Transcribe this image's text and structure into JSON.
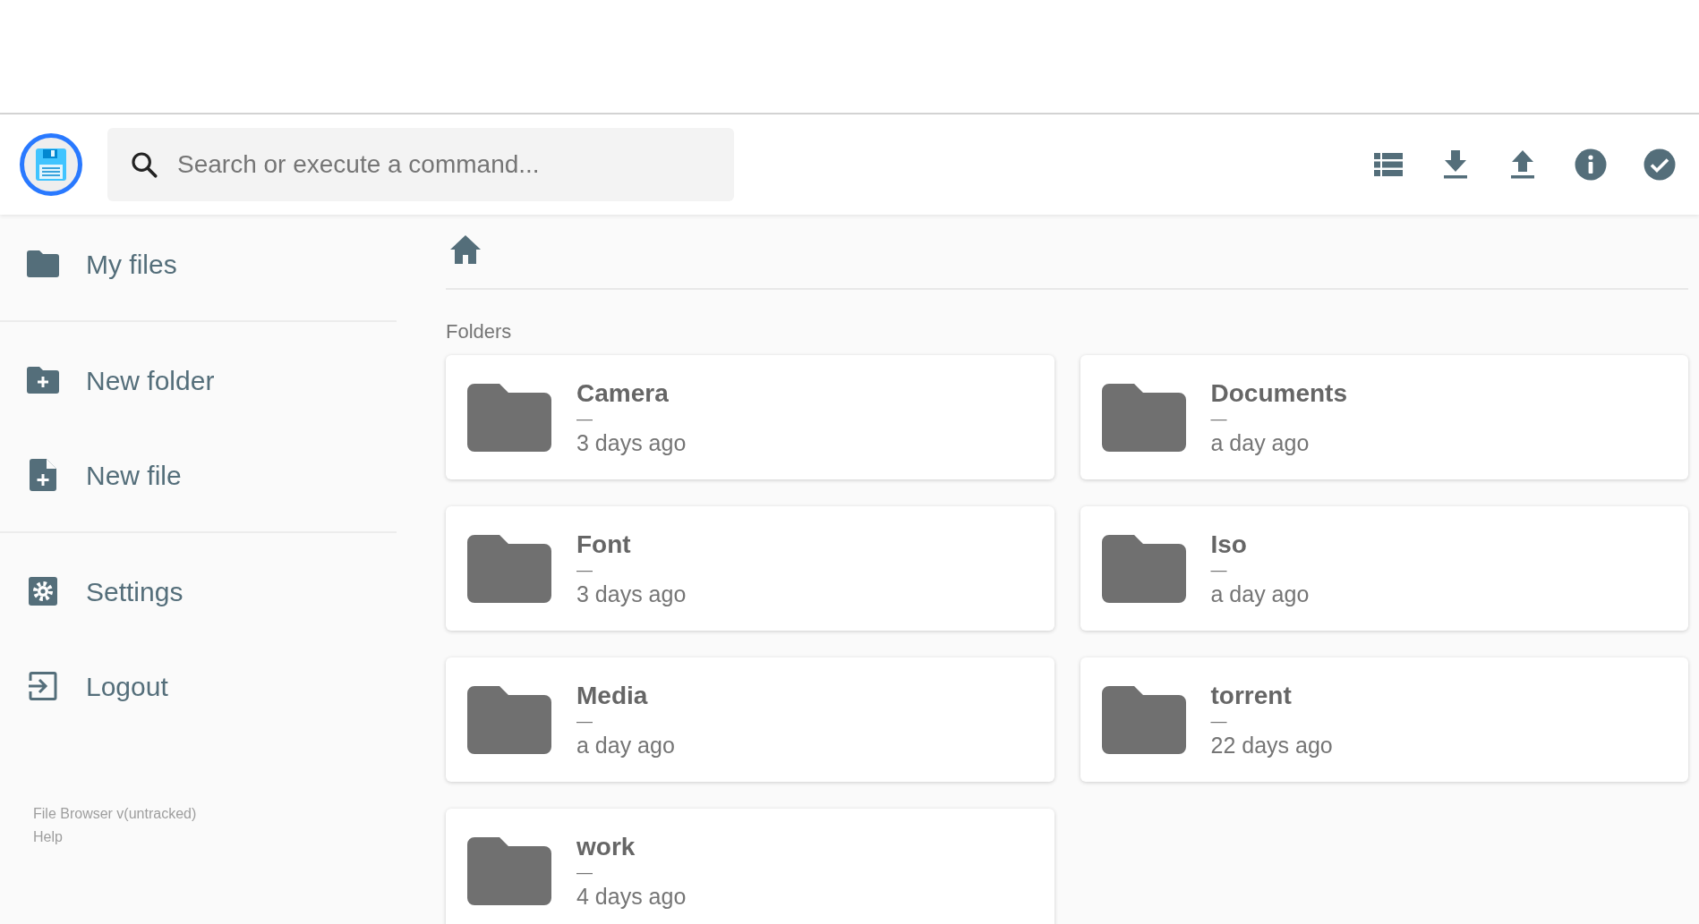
{
  "header": {
    "search": {
      "placeholder": "Search or execute a command..."
    }
  },
  "sidebar": {
    "items": [
      {
        "label": "My files",
        "kind": "folder",
        "divider_after": true
      },
      {
        "label": "New folder",
        "kind": "newfolder",
        "divider_after": false
      },
      {
        "label": "New file",
        "kind": "newfile",
        "divider_after": true
      },
      {
        "label": "Settings",
        "kind": "settings",
        "divider_after": false
      },
      {
        "label": "Logout",
        "kind": "logout",
        "divider_after": false
      }
    ],
    "footer": [
      "File Browser v(untracked)",
      "Help"
    ]
  },
  "section_title": "Folders",
  "folders": [
    {
      "name": "Camera",
      "size": "—",
      "modified": "3 days ago"
    },
    {
      "name": "Documents",
      "size": "—",
      "modified": "a day ago"
    },
    {
      "name": "Font",
      "size": "—",
      "modified": "3 days ago"
    },
    {
      "name": "Iso",
      "size": "—",
      "modified": "a day ago"
    },
    {
      "name": "Media",
      "size": "—",
      "modified": "a day ago"
    },
    {
      "name": "torrent",
      "size": "—",
      "modified": "22 days ago"
    },
    {
      "name": "work",
      "size": "—",
      "modified": "4 days ago"
    }
  ]
}
